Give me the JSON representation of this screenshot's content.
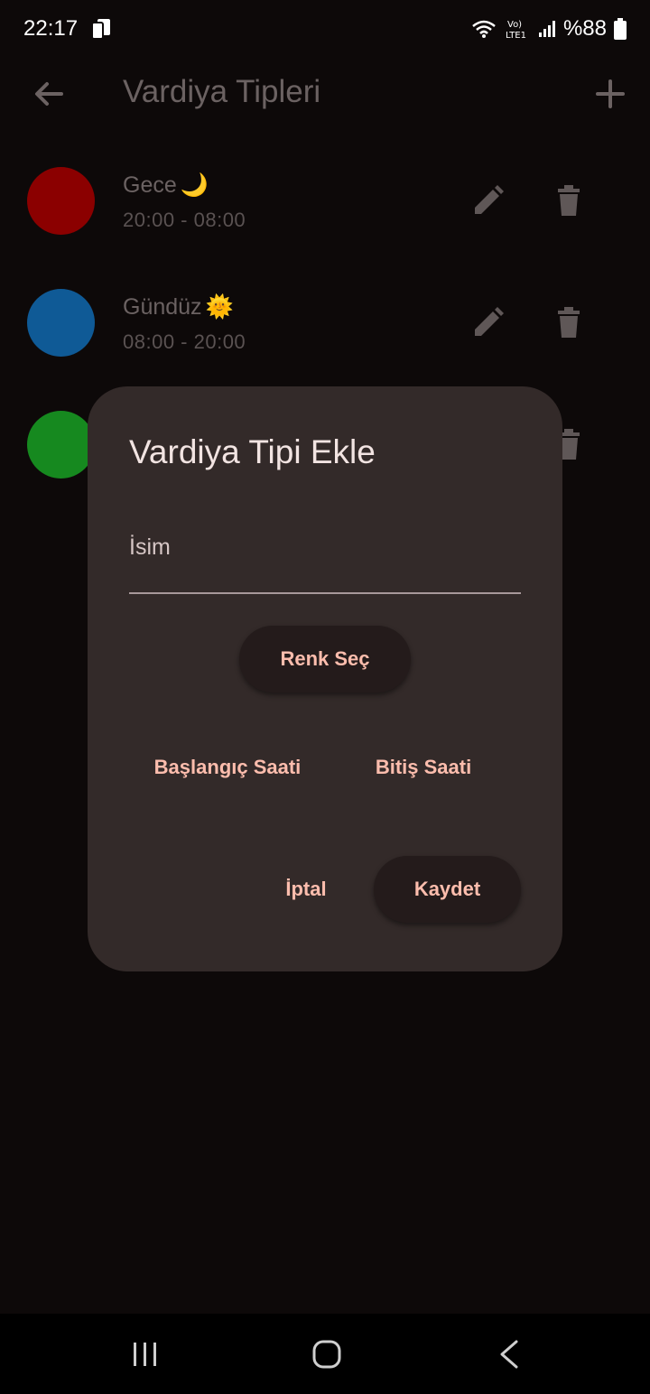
{
  "status_bar": {
    "time": "22:17",
    "battery": "%88"
  },
  "app_bar": {
    "title": "Vardiya Tipleri"
  },
  "shift_types": [
    {
      "name": "Gece",
      "emoji": "🌙",
      "hours": "20:00 - 08:00",
      "color": "#8b0000"
    },
    {
      "name": "Gündüz",
      "emoji": "🌞",
      "hours": "08:00 - 20:00",
      "color": "#0f5a96"
    },
    {
      "name": "",
      "emoji": "",
      "hours": "",
      "color": "#16891f"
    }
  ],
  "dialog": {
    "title": "Vardiya Tipi Ekle",
    "name_field_label": "İsim",
    "name_field_value": "",
    "color_button": "Renk Seç",
    "start_time_button": "Başlangıç Saati",
    "end_time_button": "Bitiş Saati",
    "cancel_button": "İptal",
    "save_button": "Kaydet"
  },
  "colors": {
    "background": "#0d0909",
    "dialog_surface": "#332a29",
    "accent_text": "#fdbdad"
  },
  "icons": {
    "back": "arrow-left-icon",
    "add": "plus-icon",
    "edit": "pencil-icon",
    "delete": "trash-icon",
    "nav_recent": "recent-apps-icon",
    "nav_home": "home-icon",
    "nav_back": "chevron-left-icon"
  }
}
